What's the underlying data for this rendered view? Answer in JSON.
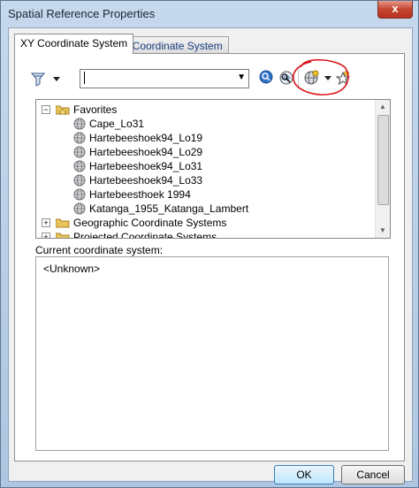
{
  "window": {
    "title": "Spatial Reference Properties",
    "close_label": "x"
  },
  "tabs": [
    {
      "label": "XY Coordinate System",
      "selected": true
    },
    {
      "label": "Z Coordinate System",
      "selected": false
    }
  ],
  "toolbar": {
    "filter_icon": "filter-icon",
    "search_value": "",
    "search_icon": "search-icon",
    "locate_icon": "locate-icon",
    "add_icon": "globe-add-icon",
    "favorite_icon": "star-icon"
  },
  "tree": {
    "favorites": {
      "label": "Favorites",
      "expander": "−",
      "items": [
        "Cape_Lo31",
        "Hartebeeshoek94_Lo19",
        "Hartebeeshoek94_Lo29",
        "Hartebeeshoek94_Lo31",
        "Hartebeeshoek94_Lo33",
        "Hartebeesthoek 1994",
        "Katanga_1955_Katanga_Lambert"
      ]
    },
    "folders": [
      {
        "label": "Geographic Coordinate Systems",
        "expander": "+"
      },
      {
        "label": "Projected Coordinate Systems",
        "expander": "+"
      }
    ]
  },
  "current": {
    "label": "Current coordinate system:",
    "value": "<Unknown>"
  },
  "buttons": {
    "ok": "OK",
    "cancel": "Cancel"
  },
  "colors": {
    "annotation_red": "#d8141c",
    "folder_yellow": "#e8c45a"
  }
}
